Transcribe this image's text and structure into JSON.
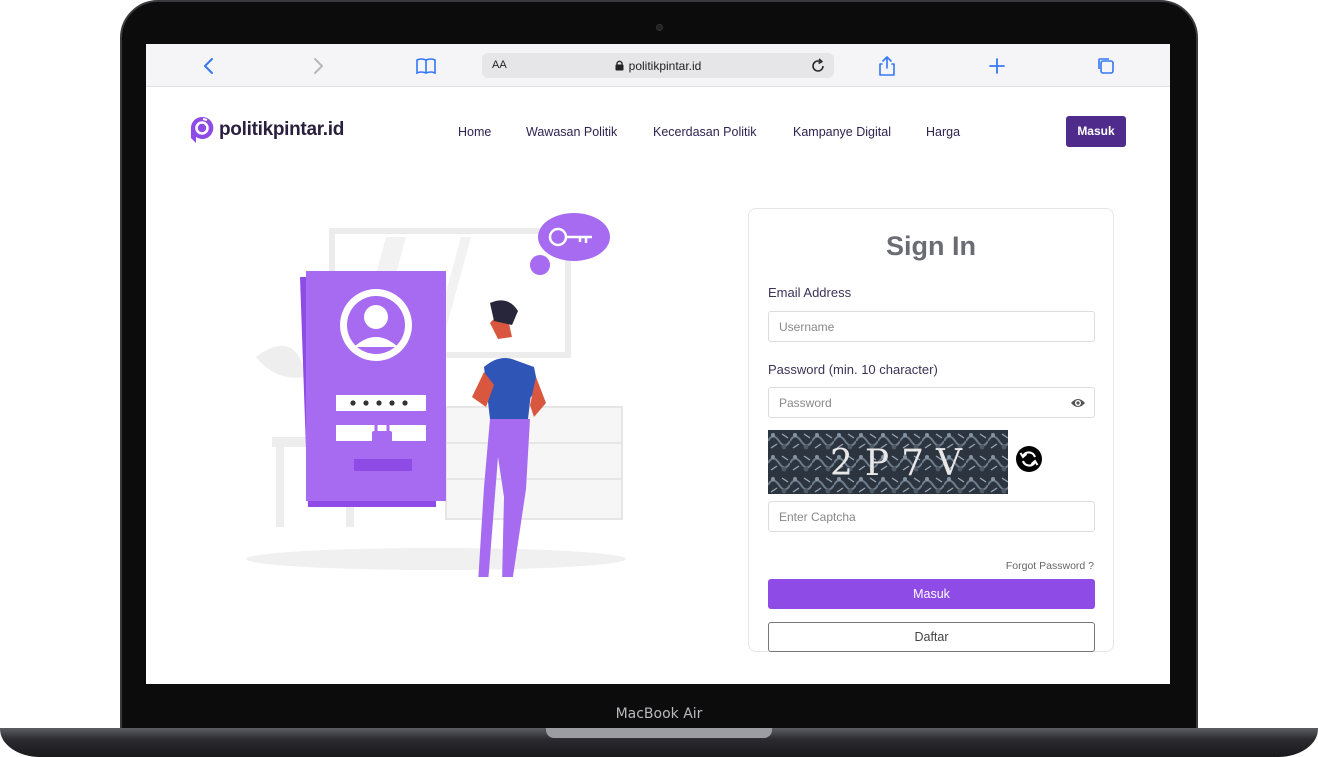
{
  "device": {
    "label": "MacBook Air"
  },
  "browser": {
    "reader_label": "AA",
    "url": "politikpintar.id",
    "icons": [
      "back-icon",
      "forward-icon",
      "bookmarks-icon",
      "lock-icon",
      "reload-icon",
      "share-icon",
      "new-tab-icon",
      "tabs-icon"
    ]
  },
  "site": {
    "brand": "politikpintar.id",
    "nav": [
      {
        "label": "Home"
      },
      {
        "label": "Wawasan Politik"
      },
      {
        "label": "Kecerdasan Politik"
      },
      {
        "label": "Kampanye Digital"
      },
      {
        "label": "Harga"
      }
    ],
    "login_button": "Masuk"
  },
  "signin": {
    "title": "Sign In",
    "email_label": "Email Address",
    "email_placeholder": "Username",
    "password_label": "Password (min. 10 character)",
    "password_placeholder": "Password",
    "captcha_text": "2P7V",
    "captcha_placeholder": "Enter Captcha",
    "forgot_label": "Forgot Password ?",
    "submit_label": "Masuk",
    "register_label": "Daftar"
  },
  "colors": {
    "brand_dark": "#4f2c8c",
    "accent": "#8f4be6",
    "illustration_purple": "#a66bf0",
    "link": "#3478f6"
  }
}
